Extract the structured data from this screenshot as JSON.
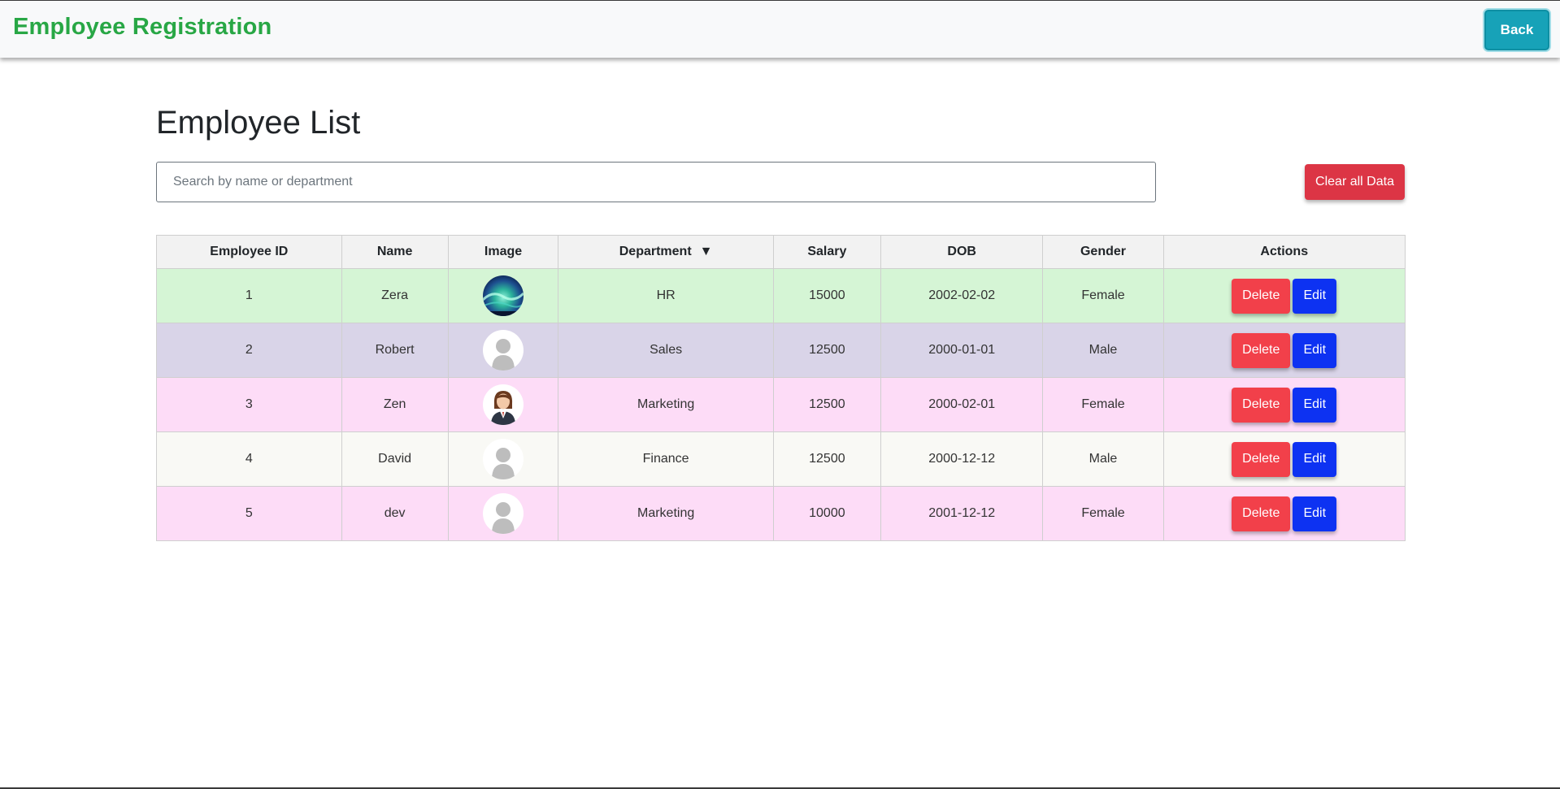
{
  "app": {
    "title": "Employee Registration",
    "back_label": "Back"
  },
  "page": {
    "heading": "Employee List"
  },
  "search": {
    "placeholder": "Search by name or department",
    "value": ""
  },
  "toolbar": {
    "clear_all_label": "Clear all Data"
  },
  "table": {
    "headers": {
      "id": "Employee ID",
      "name": "Name",
      "image": "Image",
      "department": "Department",
      "sort_indicator": "▼",
      "salary": "Salary",
      "dob": "DOB",
      "gender": "Gender",
      "actions": "Actions"
    },
    "delete_label": "Delete",
    "edit_label": "Edit",
    "rows": [
      {
        "id": "1",
        "name": "Zera",
        "image": "aurora-photo",
        "department": "HR",
        "salary": "15000",
        "dob": "2002-02-02",
        "gender": "Female",
        "row_color": "#d5f5d5"
      },
      {
        "id": "2",
        "name": "Robert",
        "image": "default-avatar",
        "department": "Sales",
        "salary": "12500",
        "dob": "2000-01-01",
        "gender": "Male",
        "row_color": "#d9d4e8"
      },
      {
        "id": "3",
        "name": "Zen",
        "image": "businesswoman-avatar",
        "department": "Marketing",
        "salary": "12500",
        "dob": "2000-02-01",
        "gender": "Female",
        "row_color": "#fddcf7"
      },
      {
        "id": "4",
        "name": "David",
        "image": "default-avatar",
        "department": "Finance",
        "salary": "12500",
        "dob": "2000-12-12",
        "gender": "Male",
        "row_color": "#f9f9f5"
      },
      {
        "id": "5",
        "name": "dev",
        "image": "default-avatar",
        "department": "Marketing",
        "salary": "10000",
        "dob": "2001-12-12",
        "gender": "Female",
        "row_color": "#fddcf7"
      }
    ]
  },
  "colors": {
    "brand": "#28a745",
    "back_button": "#17a2b8",
    "clear_button": "#dc3545",
    "delete_button": "#f2404a",
    "edit_button": "#0d32f2"
  }
}
